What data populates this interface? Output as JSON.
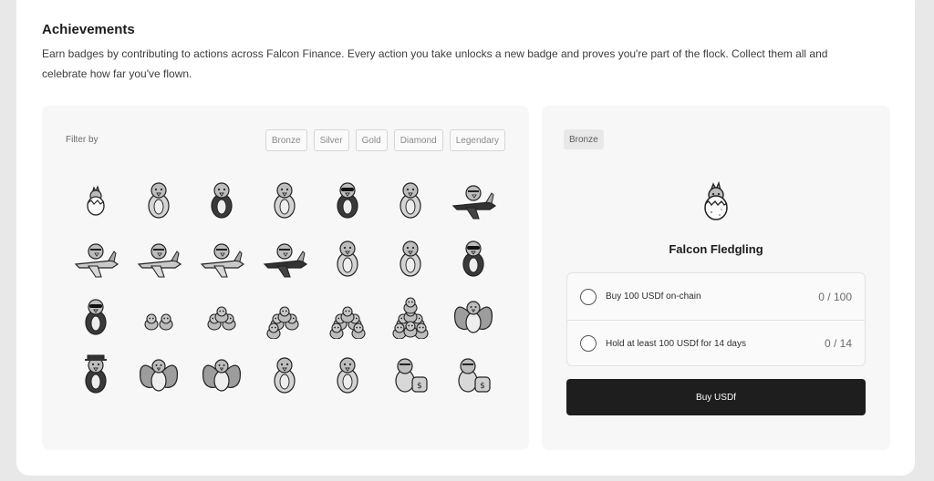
{
  "achievements": {
    "title": "Achievements",
    "description": "Earn badges by contributing to actions across Falcon Finance. Every action you take unlocks a new badge and proves you're part of the flock. Collect them all and celebrate how far you've flown."
  },
  "filter": {
    "label": "Filter by",
    "options": [
      "Bronze",
      "Silver",
      "Gold",
      "Diamond",
      "Legendary"
    ]
  },
  "badges": [
    "falcon-egg",
    "falcon-blanket",
    "falcon-sweater",
    "falcon-jacket",
    "falcon-biker",
    "falcon-pilot",
    "falcon-plane",
    "falcon-plane",
    "falcon-plane",
    "falcon-jet",
    "falcon-fighter-jet",
    "falcon-hoodie",
    "falcon-hoodie",
    "falcon-sunglasses-hood",
    "falcon-sunglasses-hood",
    "falcon-duo",
    "falcon-trio",
    "falcon-quartet",
    "falcon-flock",
    "falcon-big-flock",
    "falcon-spread-wings",
    "falcon-detective",
    "falcon-butterfly-wings",
    "falcon-butterfly-wings",
    "falcon-hug",
    "falcon-hug",
    "falcon-money-bag",
    "falcon-money-bag"
  ],
  "detail": {
    "tier": "Bronze",
    "badge_icon": "falcon-egg",
    "name": "Falcon Fledgling",
    "tasks": [
      {
        "label": "Buy 100 USDf on-chain",
        "progress": "0 / 100"
      },
      {
        "label": "Hold at least 100 USDf for 14 days",
        "progress": "0 / 14"
      }
    ],
    "cta": "Buy USDf"
  },
  "colors": {
    "background": "#e8e8e8",
    "panel": "#f7f7f7",
    "button": "#1e1e1f",
    "button_text": "#ffffff"
  }
}
